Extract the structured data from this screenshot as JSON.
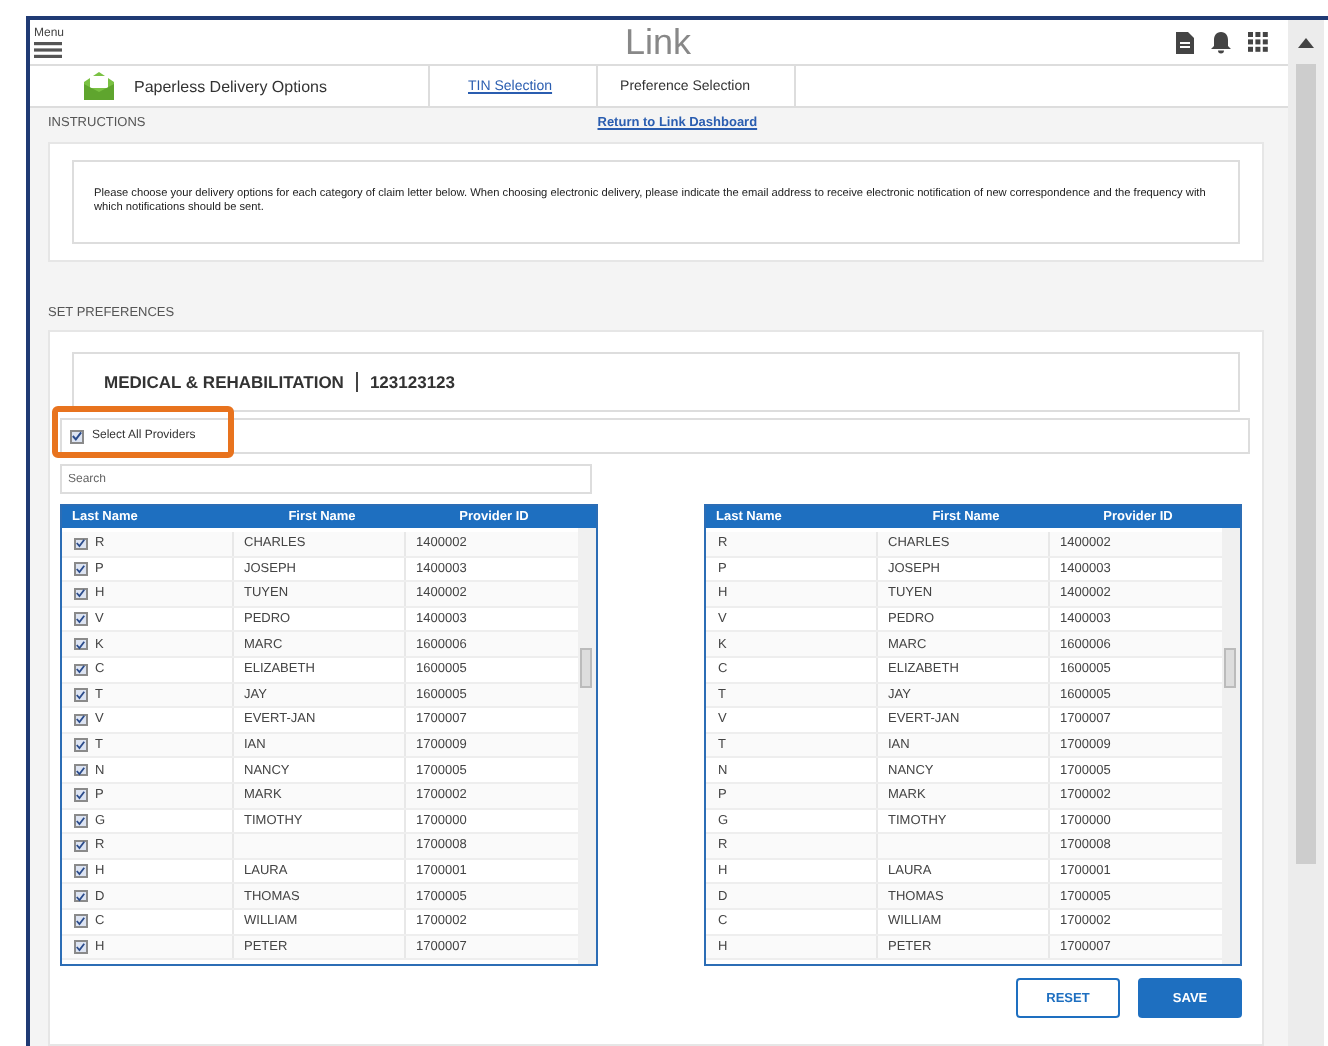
{
  "header": {
    "menu_label": "Menu",
    "logo": "Link"
  },
  "nav": {
    "title": "Paperless Delivery Options",
    "breadcrumbs": [
      {
        "label": "TIN Selection",
        "kind": "link"
      },
      {
        "label": "Preference Selection",
        "kind": "current"
      }
    ]
  },
  "instructions": {
    "label": "INSTRUCTIONS",
    "return_link": "Return to Link Dashboard",
    "text": "Please choose your delivery options for each category of claim letter below. When choosing electronic delivery, please indicate the email address to receive electronic notification of new correspondence and the frequency with which notifications should be sent."
  },
  "preferences": {
    "label": "SET PREFERENCES",
    "category": "MEDICAL & REHABILITATION",
    "tin": "123123123",
    "select_all": {
      "label": "Select All Providers",
      "checked": true
    },
    "search": {
      "placeholder": "Search"
    }
  },
  "left_table": {
    "columns": [
      "Last Name",
      "First Name",
      "Provider ID"
    ],
    "rows": [
      {
        "last": "R",
        "first": "CHARLES",
        "id": "1400002",
        "checked": true
      },
      {
        "last": "P",
        "first": "JOSEPH",
        "id": "1400003",
        "checked": true
      },
      {
        "last": "H",
        "first": "TUYEN",
        "id": "1400002",
        "checked": true
      },
      {
        "last": "V",
        "first": "PEDRO",
        "id": "1400003",
        "checked": true
      },
      {
        "last": "K",
        "first": "MARC",
        "id": "1600006",
        "checked": true
      },
      {
        "last": "C",
        "first": "ELIZABETH",
        "id": "1600005",
        "checked": true
      },
      {
        "last": "T",
        "first": "JAY",
        "id": "1600005",
        "checked": true
      },
      {
        "last": "V",
        "first": "EVERT-JAN",
        "id": "1700007",
        "checked": true
      },
      {
        "last": "T",
        "first": "IAN",
        "id": "1700009",
        "checked": true
      },
      {
        "last": "N",
        "first": "NANCY",
        "id": "1700005",
        "checked": true
      },
      {
        "last": "P",
        "first": "MARK",
        "id": "1700002",
        "checked": true
      },
      {
        "last": "G",
        "first": "TIMOTHY",
        "id": "1700000",
        "checked": true
      },
      {
        "last": "R",
        "id": "1700008",
        "checked": true
      },
      {
        "last": "H",
        "first": "LAURA",
        "id": "1700001",
        "checked": true
      },
      {
        "last": "D",
        "first": "THOMAS",
        "id": "1700005",
        "checked": true
      },
      {
        "last": "C",
        "first": "WILLIAM",
        "id": "1700002",
        "checked": true
      },
      {
        "last": "H",
        "first": "PETER",
        "id": "1700007",
        "checked": true
      }
    ]
  },
  "right_table": {
    "columns": [
      "Last Name",
      "First Name",
      "Provider ID"
    ],
    "rows": [
      {
        "last": "R",
        "first": "CHARLES",
        "id": "1400002"
      },
      {
        "last": "P",
        "first": "JOSEPH",
        "id": "1400003"
      },
      {
        "last": "H",
        "first": "TUYEN",
        "id": "1400002"
      },
      {
        "last": "V",
        "first": "PEDRO",
        "id": "1400003"
      },
      {
        "last": "K",
        "first": "MARC",
        "id": "1600006"
      },
      {
        "last": "C",
        "first": "ELIZABETH",
        "id": "1600005"
      },
      {
        "last": "T",
        "first": "JAY",
        "id": "1600005"
      },
      {
        "last": "V",
        "first": "EVERT-JAN",
        "id": "1700007"
      },
      {
        "last": "T",
        "first": "IAN",
        "id": "1700009"
      },
      {
        "last": "N",
        "first": "NANCY",
        "id": "1700005"
      },
      {
        "last": "P",
        "first": "MARK",
        "id": "1700002"
      },
      {
        "last": "G",
        "first": "TIMOTHY",
        "id": "1700000"
      },
      {
        "last": "R",
        "id": "1700008"
      },
      {
        "last": "H",
        "first": "LAURA",
        "id": "1700001"
      },
      {
        "last": "D",
        "first": "THOMAS",
        "id": "1700005"
      },
      {
        "last": "C",
        "first": "WILLIAM",
        "id": "1700002"
      },
      {
        "last": "H",
        "first": "PETER",
        "id": "1700007"
      }
    ]
  },
  "buttons": [
    {
      "label": "RESET",
      "kind": "secondary"
    },
    {
      "label": "SAVE",
      "kind": "primary"
    }
  ]
}
